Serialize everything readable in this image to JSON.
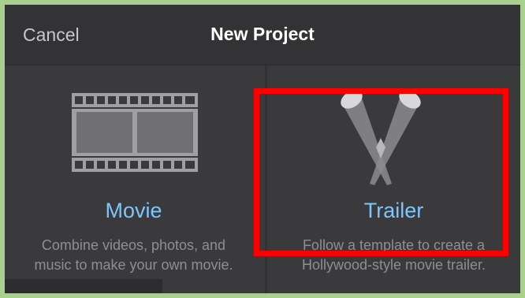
{
  "header": {
    "cancel_label": "Cancel",
    "title": "New Project"
  },
  "options": [
    {
      "label": "Movie",
      "description": "Combine videos, photos, and\nmusic to make your own movie.",
      "icon": "film-strip-icon"
    },
    {
      "label": "Trailer",
      "description": "Follow a template to create a\nHollywood-style movie trailer.",
      "icon": "spotlights-icon"
    }
  ],
  "colors": {
    "accent": "#7cc6ff",
    "highlight": "#ff0000",
    "background": "#3a3a3c"
  }
}
